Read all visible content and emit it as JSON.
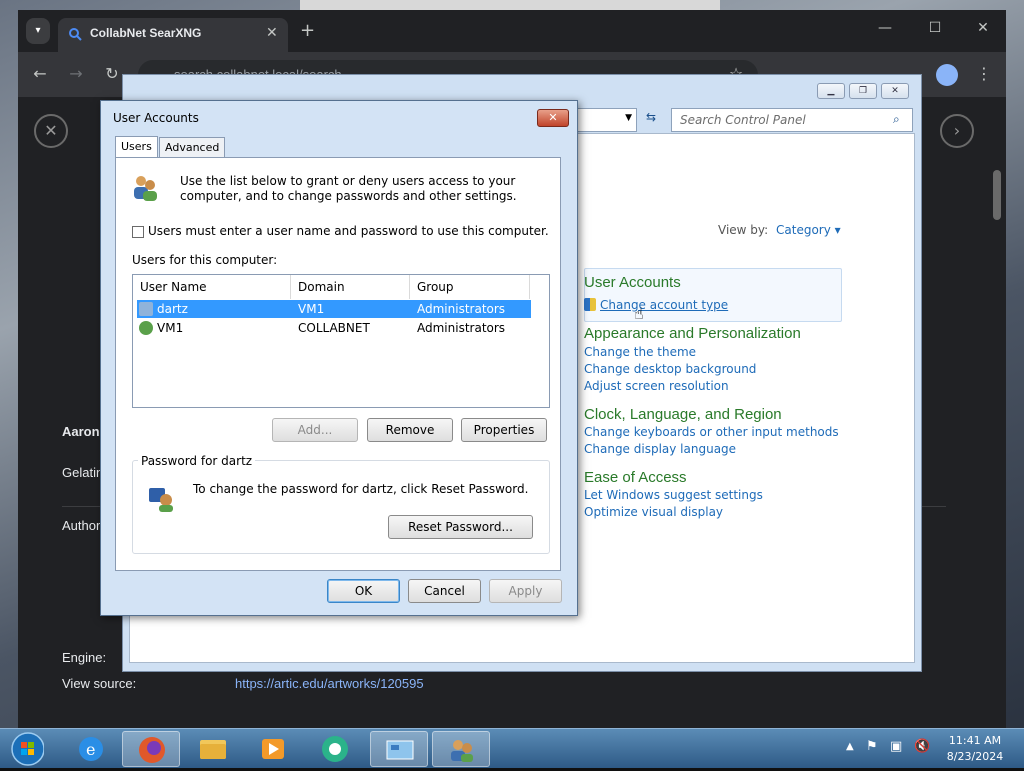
{
  "browser": {
    "tab_title": "CollabNet SearXNG",
    "url": "search.collabnet.local/search",
    "new_tab": "+",
    "min": "—",
    "max": "☐",
    "close": "✕"
  },
  "page": {
    "author_bold": "Aaron",
    "line1": "Gelatin",
    "line2": "Author",
    "engine_label": "Engine:",
    "view_source_label": "View source:",
    "view_source_url": "https://artic.edu/artworks/120595"
  },
  "control_panel": {
    "search_placeholder": "Search Control Panel",
    "view_by_label": "View by:",
    "view_by_value": "Category",
    "categories": [
      {
        "title": "User Accounts",
        "links": [
          "Change account type"
        ]
      },
      {
        "title": "Appearance and Personalization",
        "links": [
          "Change the theme",
          "Change desktop background",
          "Adjust screen resolution"
        ]
      },
      {
        "title": "Clock, Language, and Region",
        "links": [
          "Change keyboards or other input methods",
          "Change display language"
        ]
      },
      {
        "title": "Ease of Access",
        "links": [
          "Let Windows suggest settings",
          "Optimize visual display"
        ]
      }
    ]
  },
  "dialog": {
    "title": "User Accounts",
    "tabs": [
      "Users",
      "Advanced"
    ],
    "intro": "Use the list below to grant or deny users access to your computer, and to change passwords and other settings.",
    "checkbox_label": "Users must enter a user name and password to use this computer.",
    "list_label": "Users for this computer:",
    "columns": [
      "User Name",
      "Domain",
      "Group"
    ],
    "rows": [
      {
        "name": "dartz",
        "domain": "VM1",
        "group": "Administrators"
      },
      {
        "name": "VM1",
        "domain": "COLLABNET",
        "group": "Administrators"
      }
    ],
    "buttons": {
      "add": "Add...",
      "remove": "Remove",
      "properties": "Properties"
    },
    "password_group": "Password for dartz",
    "password_text": "To change the password for dartz, click Reset Password.",
    "reset_button": "Reset Password...",
    "ok": "OK",
    "cancel": "Cancel",
    "apply": "Apply"
  },
  "taskbar": {
    "time": "11:41 AM",
    "date": "8/23/2024"
  }
}
